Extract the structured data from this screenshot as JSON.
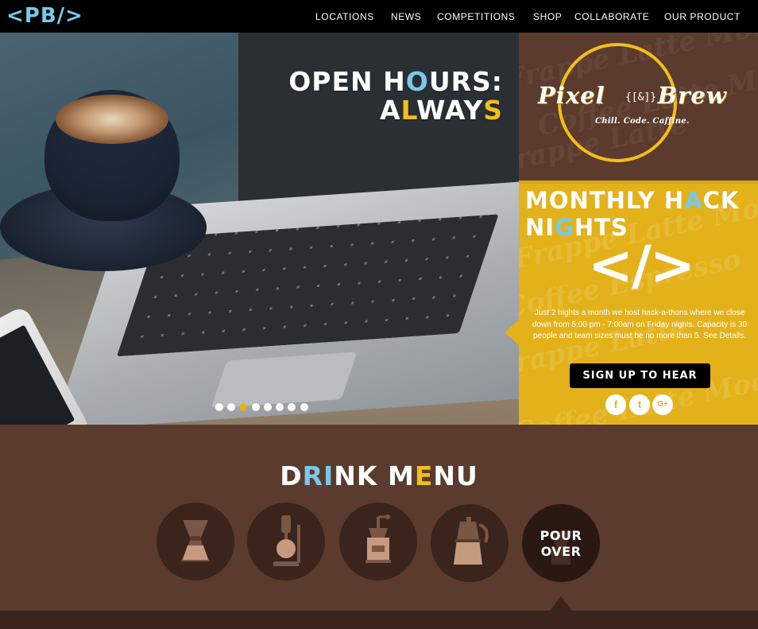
{
  "logo": {
    "lt": "<",
    "pb": "PB",
    "sl": "/>"
  },
  "nav": {
    "items": [
      {
        "label": "LOCATIONS"
      },
      {
        "label": "NEWS"
      },
      {
        "label": "COMPETITIONS"
      },
      {
        "label": "SHOP"
      },
      {
        "label": "COLLABORATE"
      },
      {
        "label": "OUR PRODUCT"
      }
    ]
  },
  "hero": {
    "line1": {
      "a": "OPEN H",
      "b": "O",
      "c": "URS:"
    },
    "line2": {
      "a": "A",
      "b": "L",
      "c": "WAY",
      "d": "S"
    },
    "slides_total": 8,
    "active_slide": 3
  },
  "brand": {
    "name_left": "Pixel",
    "name_mid": "{[&]}",
    "name_right": "Brew",
    "tagline": "Chill. Code. Caffine.",
    "bg_words": [
      "Frappe Latte Mocha",
      "Coffee Latte Mocha",
      "Frappe Latte",
      "Coffee Espresso"
    ]
  },
  "hack": {
    "title1": {
      "a": "MONTHLY H",
      "b": "A",
      "c": "CK"
    },
    "title2": {
      "a": "NI",
      "b": "G",
      "c": "HTS"
    },
    "code": "</>",
    "description": "Just 2 nights a month we host hack-a-thons where we close down from 5:00 pm - 7:00am on Friday nights. Capacity is 30 people and team sizes must be no more than 5. See Details.",
    "signup_label": "SIGN UP TO HEAR",
    "socials": [
      {
        "icon": "f"
      },
      {
        "icon": "t"
      },
      {
        "icon": "G+"
      }
    ]
  },
  "drink_menu": {
    "title": {
      "a": "D",
      "b": "RI",
      "c": "NK M",
      "d": "E",
      "e": "NU"
    },
    "items": [
      {
        "name": "chemex"
      },
      {
        "name": "siphon"
      },
      {
        "name": "grinder"
      },
      {
        "name": "moka-pot"
      },
      {
        "name": "pour-over",
        "label1": "POUR",
        "label2": "OVER"
      }
    ]
  },
  "colors": {
    "accent_yellow": "#e3b21a",
    "accent_blue": "#79c8e8",
    "brown": "#5a3b2e",
    "dark_brown": "#3a241b"
  }
}
